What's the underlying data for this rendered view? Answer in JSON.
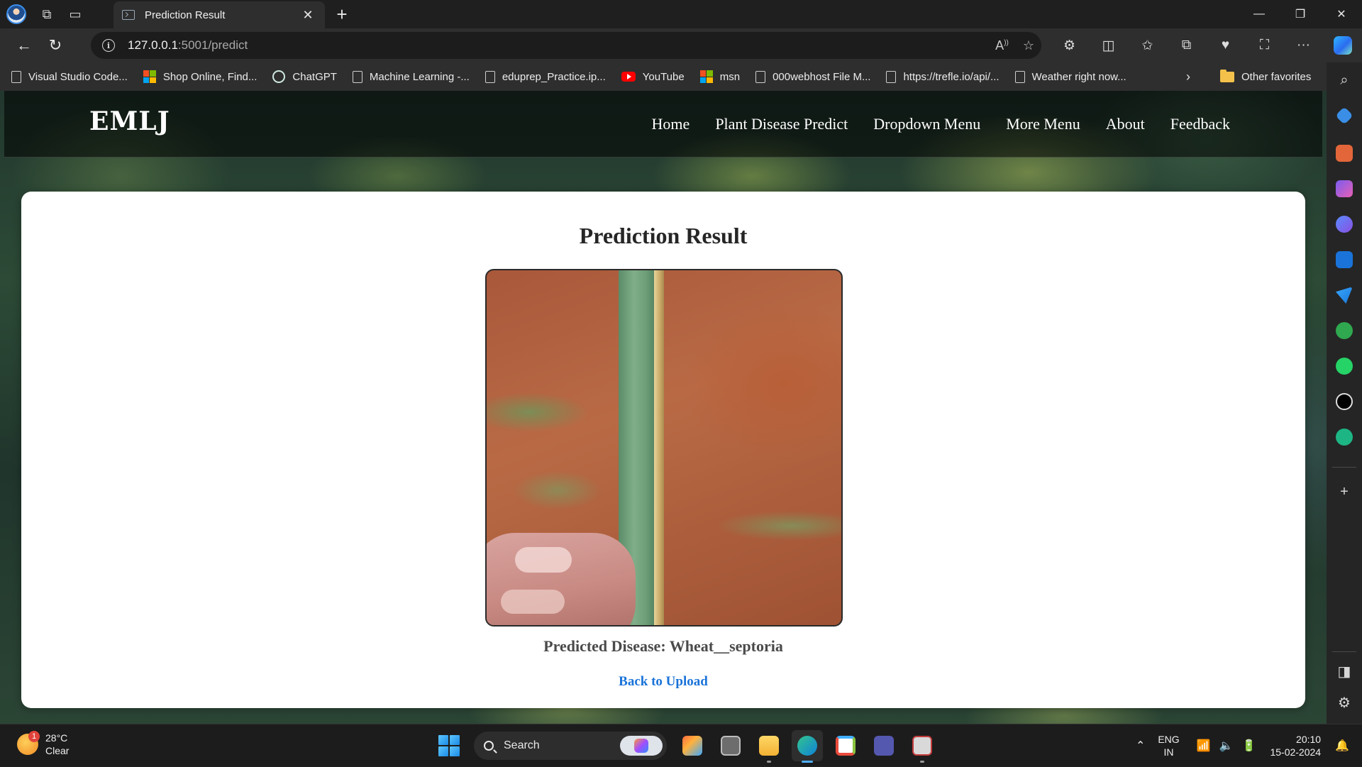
{
  "browser": {
    "tab_title": "Prediction Result",
    "url_host": "127.0.0.1",
    "url_path": ":5001/predict",
    "bookmarks": [
      {
        "label": "Visual Studio Code...",
        "icon": "page-icon"
      },
      {
        "label": "Shop Online, Find...",
        "icon": "microsoft-icon"
      },
      {
        "label": "ChatGPT",
        "icon": "chatgpt-icon"
      },
      {
        "label": "Machine Learning -...",
        "icon": "page-icon"
      },
      {
        "label": "eduprep_Practice.ip...",
        "icon": "page-icon"
      },
      {
        "label": "YouTube",
        "icon": "youtube-icon"
      },
      {
        "label": "msn",
        "icon": "microsoft-icon"
      },
      {
        "label": "000webhost File M...",
        "icon": "page-icon"
      },
      {
        "label": "https://trefle.io/api/...",
        "icon": "page-icon"
      },
      {
        "label": "Weather right now...",
        "icon": "page-icon"
      }
    ],
    "other_favorites": "Other favorites"
  },
  "site": {
    "logo": "EMLJ",
    "nav": [
      "Home",
      "Plant Disease Predict",
      "Dropdown Menu",
      "More Menu",
      "About",
      "Feedback"
    ]
  },
  "result": {
    "title": "Prediction Result",
    "predicted": "Predicted Disease: Wheat__septoria",
    "back_link": "Back to Upload"
  },
  "taskbar": {
    "temperature": "28°C",
    "condition": "Clear",
    "weather_badge": "1",
    "search_label": "Search",
    "lang_top": "ENG",
    "lang_bottom": "IN",
    "time": "20:10",
    "date": "15-02-2024"
  }
}
